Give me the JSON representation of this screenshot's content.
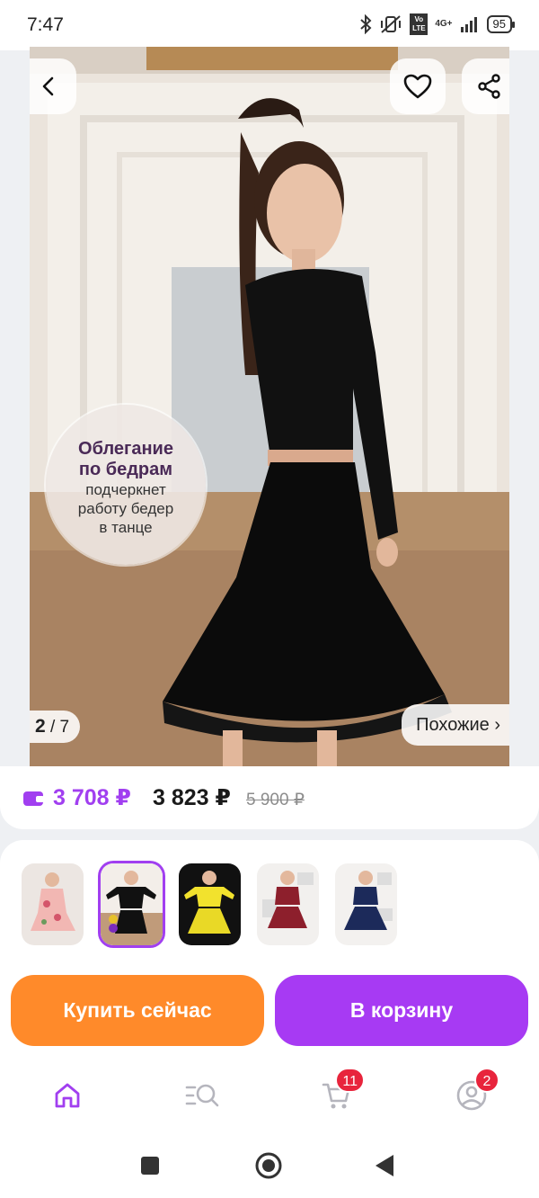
{
  "status": {
    "time": "7:47",
    "network_label": "4G+",
    "volte": "Vo LTE",
    "battery": "95"
  },
  "hero": {
    "back_icon": "back-chevron-icon",
    "favorite_icon": "heart-icon",
    "share_icon": "share-icon",
    "page_current": "2",
    "page_total": "/ 7",
    "similar_label": "Похожие ›",
    "promo": {
      "line1": "Облегание",
      "line2": "по бедрам",
      "line3": "подчеркнет",
      "line4": "работу бедер",
      "line5": "в танце"
    }
  },
  "price": {
    "wallet_price": "3 708 ₽",
    "regular_price": "3 823 ₽",
    "old_price": "5 900 ₽",
    "accent": "#a13ff0"
  },
  "thumbnails": [
    {
      "name": "floral dress",
      "selected": false
    },
    {
      "name": "black set",
      "selected": true
    },
    {
      "name": "yellow set",
      "selected": false
    },
    {
      "name": "burgundy set",
      "selected": false
    },
    {
      "name": "navy set",
      "selected": false
    }
  ],
  "actions": {
    "buy_now": "Купить сейчас",
    "add_to_cart": "В корзину",
    "buy_color": "#ff8a2a",
    "cart_color": "#a73af3"
  },
  "bottom_nav": {
    "items": [
      {
        "icon": "home-icon",
        "active": true
      },
      {
        "icon": "catalog-search-icon",
        "active": false
      },
      {
        "icon": "cart-icon",
        "badge": "11"
      },
      {
        "icon": "profile-icon",
        "badge": "2"
      }
    ]
  },
  "system_nav": [
    "recent-apps-icon",
    "home-circle-icon",
    "back-triangle-icon"
  ]
}
